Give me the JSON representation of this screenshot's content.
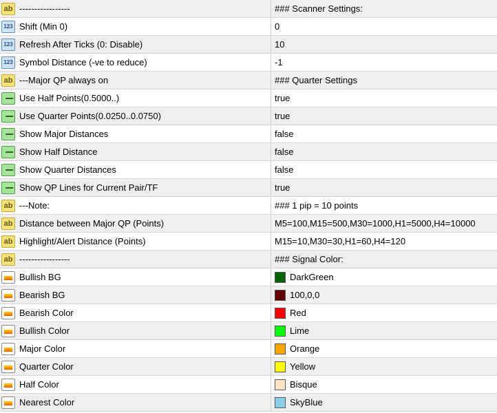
{
  "rows": [
    {
      "type": "ab",
      "icon": "string-icon",
      "name": "-----------------",
      "value": "### Scanner Settings:"
    },
    {
      "type": "num",
      "icon": "integer-icon",
      "name": "Shift (Min 0)",
      "value": "0"
    },
    {
      "type": "num",
      "icon": "integer-icon",
      "name": "Refresh After Ticks (0: Disable)",
      "value": "10"
    },
    {
      "type": "num",
      "icon": "integer-icon",
      "name": "Symbol Distance (-ve to reduce)",
      "value": "-1"
    },
    {
      "type": "ab",
      "icon": "string-icon",
      "name": "---Major QP always on",
      "value": "### Quarter Settings"
    },
    {
      "type": "bool",
      "icon": "boolean-icon",
      "name": "Use Half Points(0.5000..)",
      "value": "true"
    },
    {
      "type": "bool",
      "icon": "boolean-icon",
      "name": "Use Quarter Points(0.0250..0.0750)",
      "value": "true"
    },
    {
      "type": "bool",
      "icon": "boolean-icon",
      "name": "Show Major Distances",
      "value": "false"
    },
    {
      "type": "bool",
      "icon": "boolean-icon",
      "name": "Show Half Distance",
      "value": "false"
    },
    {
      "type": "bool",
      "icon": "boolean-icon",
      "name": "Show Quarter Distances",
      "value": "false"
    },
    {
      "type": "bool",
      "icon": "boolean-icon",
      "name": "Show QP Lines for Current Pair/TF",
      "value": "true"
    },
    {
      "type": "ab",
      "icon": "string-icon",
      "name": "---Note:",
      "value": "### 1 pip = 10 points"
    },
    {
      "type": "ab",
      "icon": "string-icon",
      "name": "Distance between Major QP (Points)",
      "value": "M5=100,M15=500,M30=1000,H1=5000,H4=10000"
    },
    {
      "type": "ab",
      "icon": "string-icon",
      "name": "Highlight/Alert Distance (Points)",
      "value": "M15=10,M30=30,H1=60,H4=120"
    },
    {
      "type": "ab",
      "icon": "string-icon",
      "name": "-----------------",
      "value": "### Signal Color:"
    },
    {
      "type": "color",
      "icon": "color-icon",
      "name": "Bullish BG",
      "value": "DarkGreen",
      "swatch": "#006400"
    },
    {
      "type": "color",
      "icon": "color-icon",
      "name": "Bearish BG",
      "value": "100,0,0",
      "swatch": "#640000"
    },
    {
      "type": "color",
      "icon": "color-icon",
      "name": "Bearish Color",
      "value": "Red",
      "swatch": "#ff0000"
    },
    {
      "type": "color",
      "icon": "color-icon",
      "name": "Bullish Color",
      "value": "Lime",
      "swatch": "#00ff00"
    },
    {
      "type": "color",
      "icon": "color-icon",
      "name": "Major Color",
      "value": "Orange",
      "swatch": "#ffa500"
    },
    {
      "type": "color",
      "icon": "color-icon",
      "name": "Quarter Color",
      "value": "Yellow",
      "swatch": "#ffff00"
    },
    {
      "type": "color",
      "icon": "color-icon",
      "name": "Half Color",
      "value": "Bisque",
      "swatch": "#ffe4c4"
    },
    {
      "type": "color",
      "icon": "color-icon",
      "name": "Nearest Color",
      "value": "SkyBlue",
      "swatch": "#87ceeb"
    }
  ],
  "icon_text": {
    "ab": "ab",
    "num": "123"
  }
}
